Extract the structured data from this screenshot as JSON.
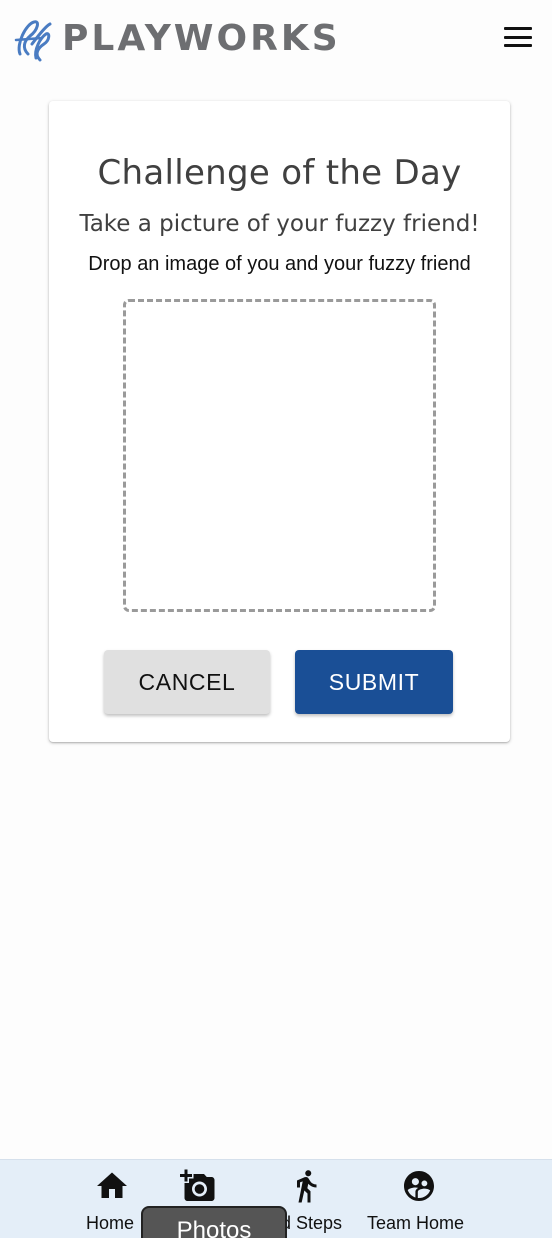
{
  "header": {
    "brand": "PLAYWORKS",
    "logo_icon": "playworks-logo-icon",
    "menu_icon": "hamburger-menu-icon"
  },
  "card": {
    "title": "Challenge of the Day",
    "subtitle": "Take a picture of your fuzzy friend!",
    "instruction": "Drop an image of you and your fuzzy friend",
    "cancel_label": "CANCEL",
    "submit_label": "SUBMIT"
  },
  "bottom_nav": {
    "items": [
      {
        "label": "Home",
        "icon": "home-icon"
      },
      {
        "label": "Photos",
        "icon": "add-photo-icon"
      },
      {
        "label": "Add Steps",
        "visible_label": "d Steps",
        "icon": "walking-person-icon"
      },
      {
        "label": "Team Home",
        "icon": "team-icon"
      }
    ],
    "tooltip": "Photos"
  },
  "colors": {
    "brand_text": "#6d6e71",
    "logo_blue": "#4a7cc2",
    "submit_bg": "#1a4f96",
    "cancel_bg": "#e0e0e0",
    "nav_bg": "#e4eef8"
  }
}
